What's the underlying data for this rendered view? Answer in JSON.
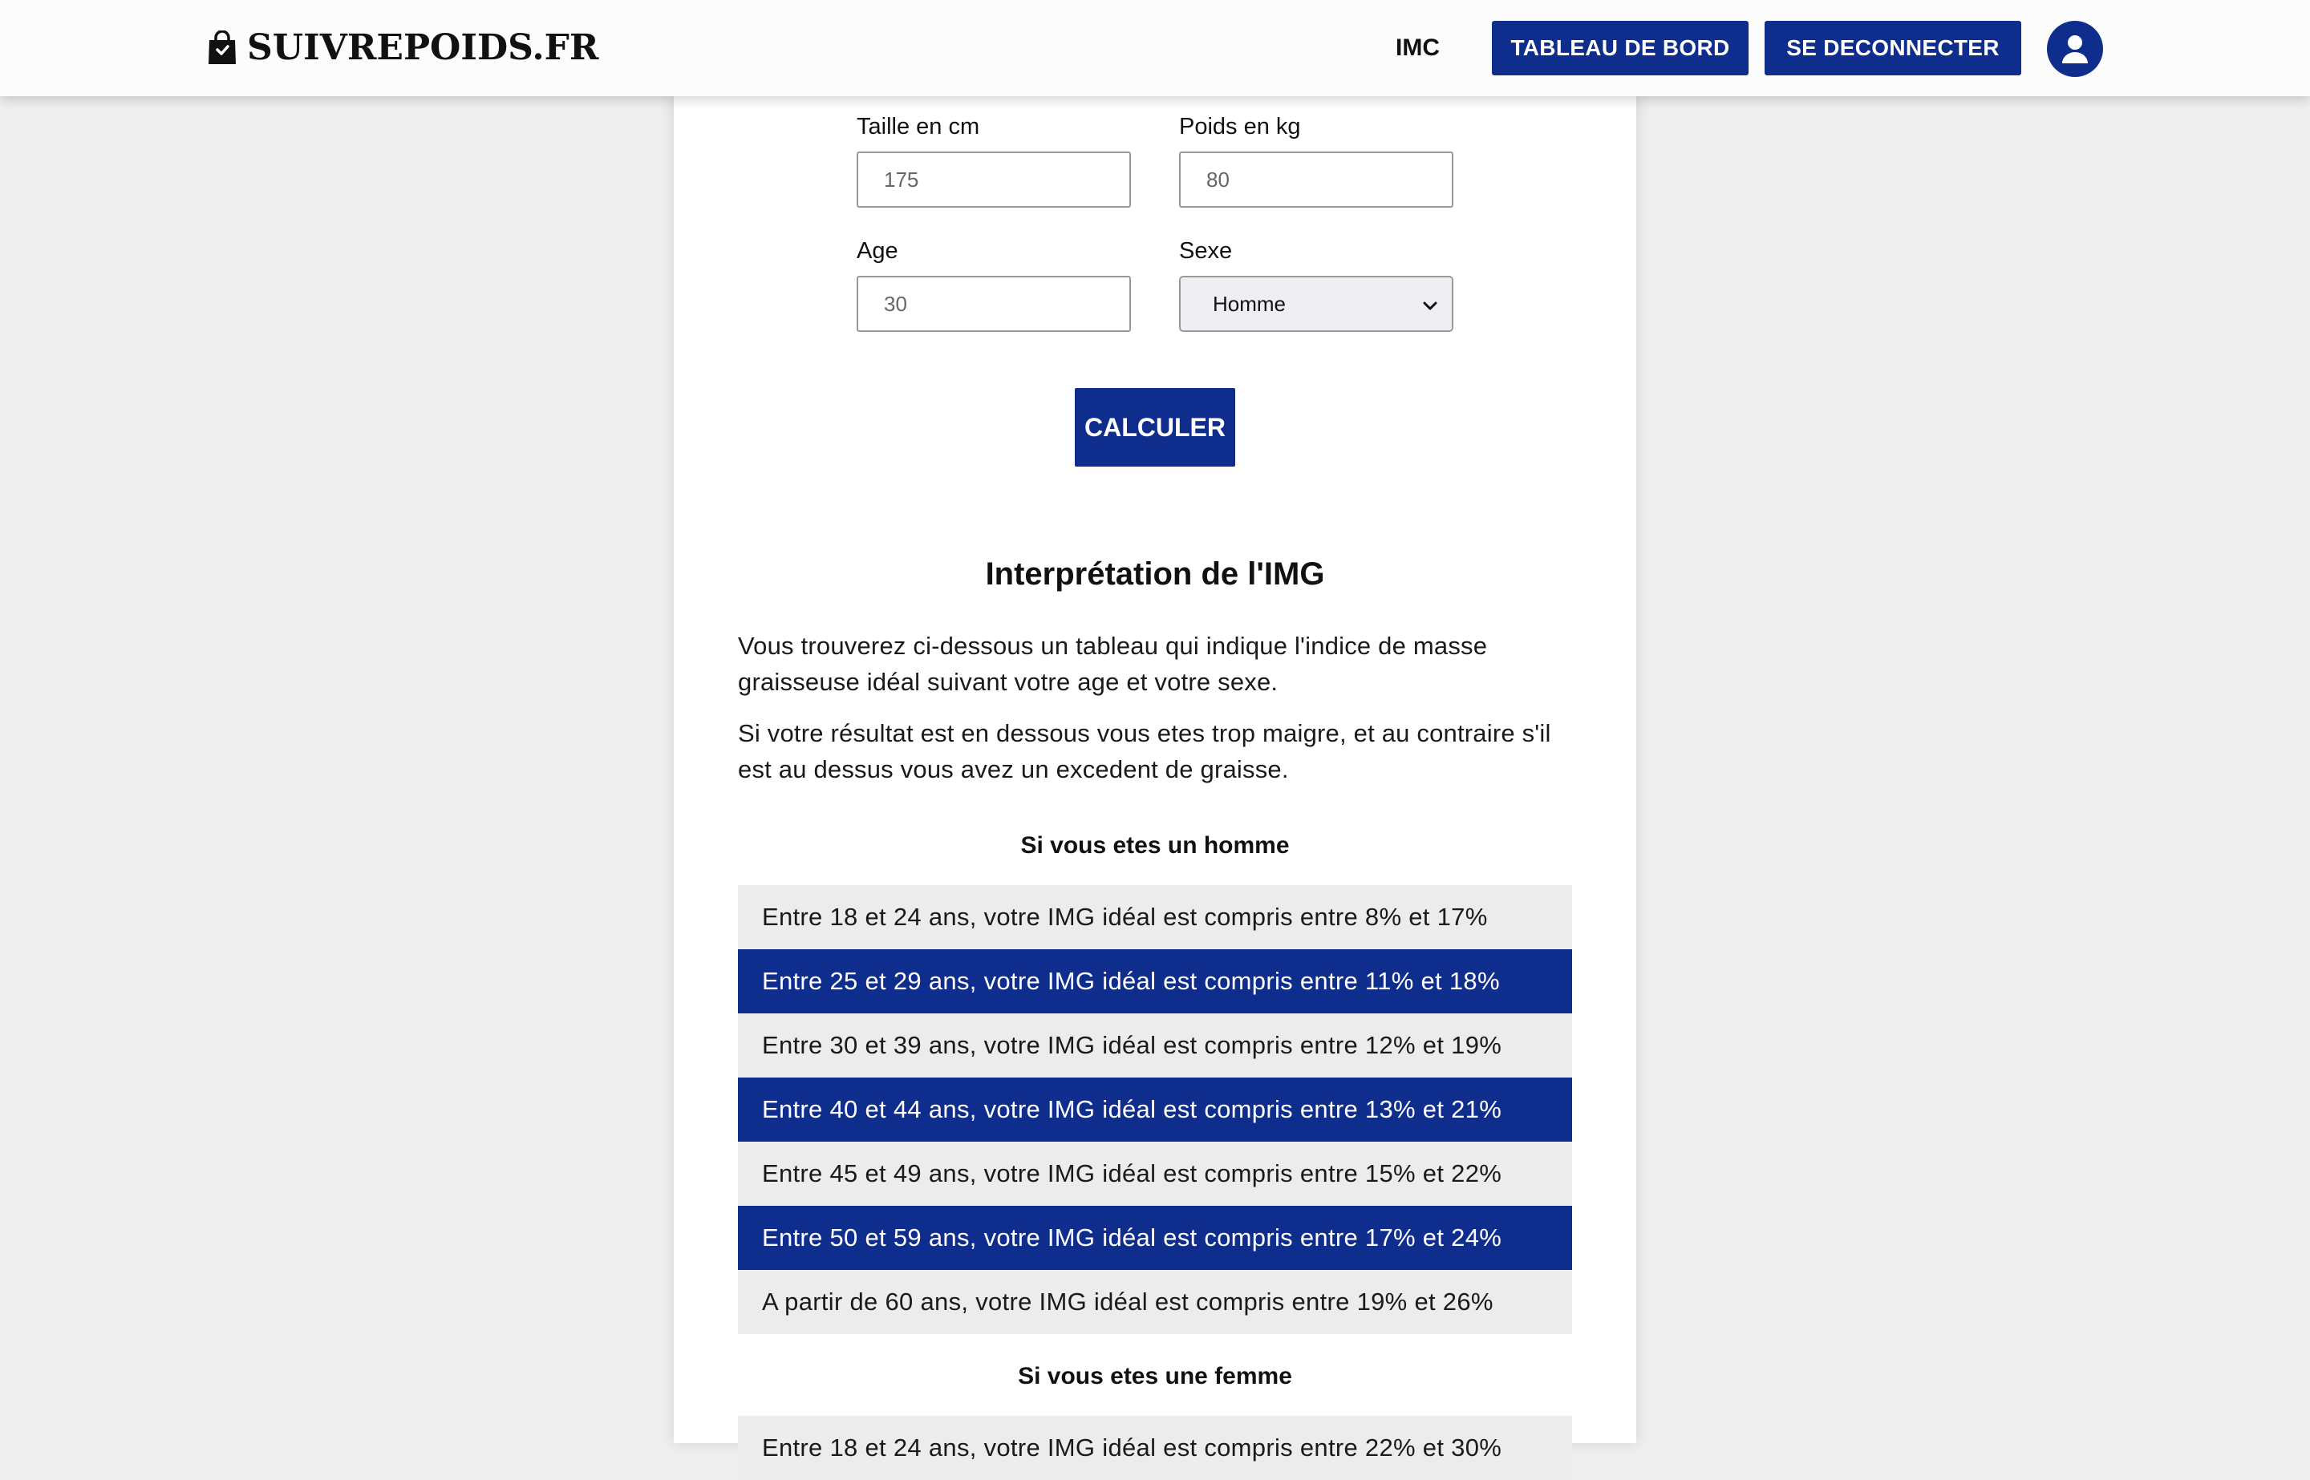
{
  "header": {
    "brand": "SUIVREPOIDS.FR",
    "brand_icon": "shopping-bag-icon",
    "nav_imc": "IMC",
    "dashboard_label": "TABLEAU DE BORD",
    "logout_label": "SE DECONNECTER",
    "avatar_icon": "user-icon"
  },
  "colors": {
    "primary": "#0f2d8c",
    "row_light": "#ececec",
    "background": "#efefef"
  },
  "form": {
    "height_label": "Taille en cm",
    "height_placeholder": "175",
    "weight_label": "Poids en kg",
    "weight_placeholder": "80",
    "age_label": "Age",
    "age_placeholder": "30",
    "sex_label": "Sexe",
    "sex_value": "Homme",
    "submit_label": "CALCULER"
  },
  "interpretation": {
    "title": "Interprétation de l'IMG",
    "paragraph1": "Vous trouverez ci-dessous un tableau qui indique l'indice de masse graisseuse idéal suivant votre age et votre sexe.",
    "paragraph2": "Si votre résultat est en dessous vous etes trop maigre, et au contraire s'il est au dessus vous avez un excedent de graisse.",
    "men_title": "Si vous etes un homme",
    "men_rows": [
      "Entre 18 et 24 ans, votre IMG idéal est compris entre 8% et 17%",
      "Entre 25 et 29 ans, votre IMG idéal est compris entre 11% et 18%",
      "Entre 30 et 39 ans, votre IMG idéal est compris entre 12% et 19%",
      "Entre 40 et 44 ans, votre IMG idéal est compris entre 13% et 21%",
      "Entre 45 et 49 ans, votre IMG idéal est compris entre 15% et 22%",
      "Entre 50 et 59 ans, votre IMG idéal est compris entre 17% et 24%",
      "A partir de 60 ans, votre IMG idéal est compris entre 19% et 26%"
    ],
    "women_title": "Si vous etes une femme",
    "women_rows": [
      "Entre 18 et 24 ans, votre IMG idéal est compris entre 22% et 30%"
    ]
  }
}
